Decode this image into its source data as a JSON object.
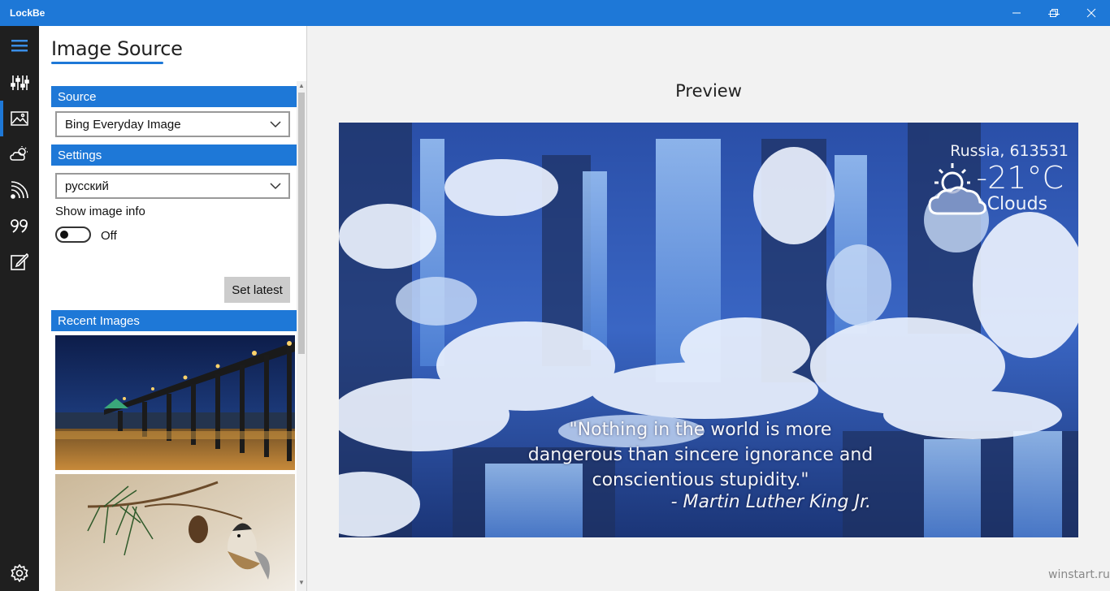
{
  "app": {
    "title": "LockBe"
  },
  "window_controls": {
    "minimize": "—",
    "restore": "❐",
    "close": "✕"
  },
  "rail": {
    "items": [
      {
        "name": "menu-icon"
      },
      {
        "name": "sliders-icon"
      },
      {
        "name": "image-icon"
      },
      {
        "name": "weather-icon"
      },
      {
        "name": "rss-icon"
      },
      {
        "name": "quote-icon"
      },
      {
        "name": "edit-icon"
      },
      {
        "name": "settings-icon"
      }
    ],
    "accent": "#1e78d7"
  },
  "panel": {
    "title": "Image Source",
    "source_header": "Source",
    "source_value": "Bing Everyday Image",
    "settings_header": "Settings",
    "language_value": "русский",
    "show_image_info_label": "Show image info",
    "toggle_state": "Off",
    "set_latest_label": "Set latest",
    "recent_header": "Recent Images"
  },
  "preview": {
    "title": "Preview",
    "location": "Russia, 613531",
    "temperature": "-21°C",
    "condition": "Clouds",
    "quote": "\"Nothing in the world is more dangerous than sincere ignorance and conscientious stupidity.\"",
    "author": "- Martin Luther King Jr."
  },
  "watermark": "winstart.ru"
}
